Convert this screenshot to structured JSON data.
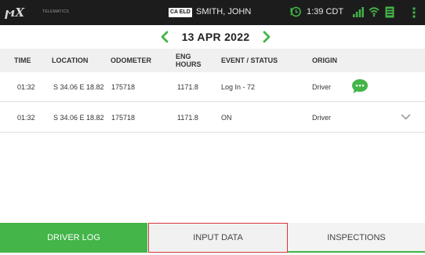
{
  "status_bar": {
    "logo": "MX",
    "logo_sub": "TELEMATICS",
    "eld_badge": "CA ELD",
    "driver_name": "SMITH, JOHN",
    "time": "1:39 CDT",
    "icons": [
      "clock-alert-icon",
      "signal-icon",
      "wifi-icon",
      "document-icon",
      "more-vert-icon"
    ],
    "accent_color": "#43b549"
  },
  "date_nav": {
    "date": "13 APR 2022",
    "prev_icon": "chevron-left-icon",
    "next_icon": "chevron-right-icon"
  },
  "table": {
    "headers": {
      "time": "TIME",
      "location": "LOCATION",
      "odometer": "ODOMETER",
      "eng_hours": "ENG HOURS",
      "event_status": "EVENT / STATUS",
      "origin": "ORIGIN"
    },
    "rows": [
      {
        "time": "01:32",
        "location": "S 34.06 E 18.82",
        "odometer": "175718",
        "eng_hours": "1171.8",
        "event_status": "Log In - 72",
        "origin": "Driver",
        "action_icon": "chat-bubble-icon"
      },
      {
        "time": "01:32",
        "location": "S 34.06 E 18.82",
        "odometer": "175718",
        "eng_hours": "1171.8",
        "event_status": "ON",
        "origin": "Driver",
        "action_icon": "chevron-down-icon"
      }
    ]
  },
  "tabs": {
    "driver_log": "DRIVER LOG",
    "input_data": "INPUT DATA",
    "inspections": "INSPECTIONS",
    "active_color": "#43b549",
    "highlight_color": "#d9363e"
  }
}
